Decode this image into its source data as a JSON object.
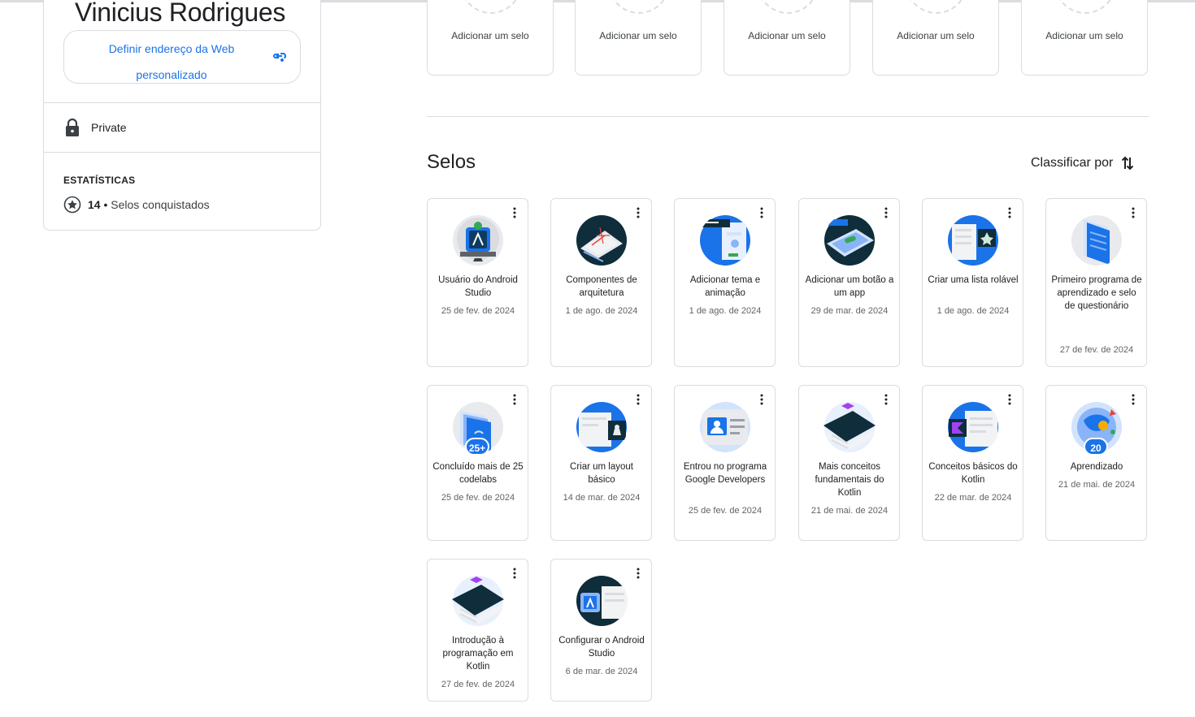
{
  "profile": {
    "name": "Vinicius Rodrigues",
    "url_line1": "Definir endereço da Web",
    "url_line2": "personalizado",
    "privacy": "Private",
    "stats_title": "ESTATÍSTICAS",
    "stats_count": "14",
    "stats_separator": " • ",
    "stats_label": "Selos conquistados"
  },
  "placeholders": [
    {
      "label": "Adicionar um selo"
    },
    {
      "label": "Adicionar um selo"
    },
    {
      "label": "Adicionar um selo"
    },
    {
      "label": "Adicionar um selo"
    },
    {
      "label": "Adicionar um selo"
    }
  ],
  "section": {
    "title": "Selos",
    "sort_label": "Classificar por"
  },
  "badges": [
    {
      "name": "Usuário do Android Studio",
      "date": "25 de fev. de 2024",
      "icon": "android-studio-badge-icon"
    },
    {
      "name": "Componentes de arquitetura",
      "date": "1 de ago. de 2024",
      "icon": "architecture-badge-icon"
    },
    {
      "name": "Adicionar tema e animação",
      "date": "1 de ago. de 2024",
      "icon": "theme-badge-icon"
    },
    {
      "name": "Adicionar um botão a um app",
      "date": "29 de mar. de 2024",
      "icon": "button-badge-icon"
    },
    {
      "name": "Criar uma lista rolável",
      "date": "1 de ago. de 2024",
      "icon": "list-badge-icon"
    },
    {
      "name": "Primeiro programa de aprendizado e selo de questionário",
      "date": "27 de fev. de 2024",
      "icon": "quiz-badge-icon"
    },
    {
      "name": "Concluído mais de 25 codelabs",
      "date": "25 de fev. de 2024",
      "icon": "codelabs-badge-icon",
      "chip": "25+"
    },
    {
      "name": "Criar um layout básico",
      "date": "14 de mar. de 2024",
      "icon": "layout-badge-icon"
    },
    {
      "name": "Entrou no programa Google Developers",
      "date": "25 de fev. de 2024",
      "icon": "developer-program-badge-icon"
    },
    {
      "name": "Mais conceitos fundamentais do Kotlin",
      "date": "21 de mai. de 2024",
      "icon": "kotlin-more-badge-icon"
    },
    {
      "name": "Conceitos básicos do Kotlin",
      "date": "22 de mar. de 2024",
      "icon": "kotlin-basics-badge-icon"
    },
    {
      "name": "Aprendizado",
      "date": "21 de mai. de 2024",
      "icon": "learning-badge-icon",
      "chip": "20"
    },
    {
      "name": "Introdução à programação em Kotlin",
      "date": "27 de fev. de 2024",
      "icon": "kotlin-intro-badge-icon"
    },
    {
      "name": "Configurar o Android Studio",
      "date": "6 de mar. de 2024",
      "icon": "setup-studio-badge-icon"
    }
  ]
}
